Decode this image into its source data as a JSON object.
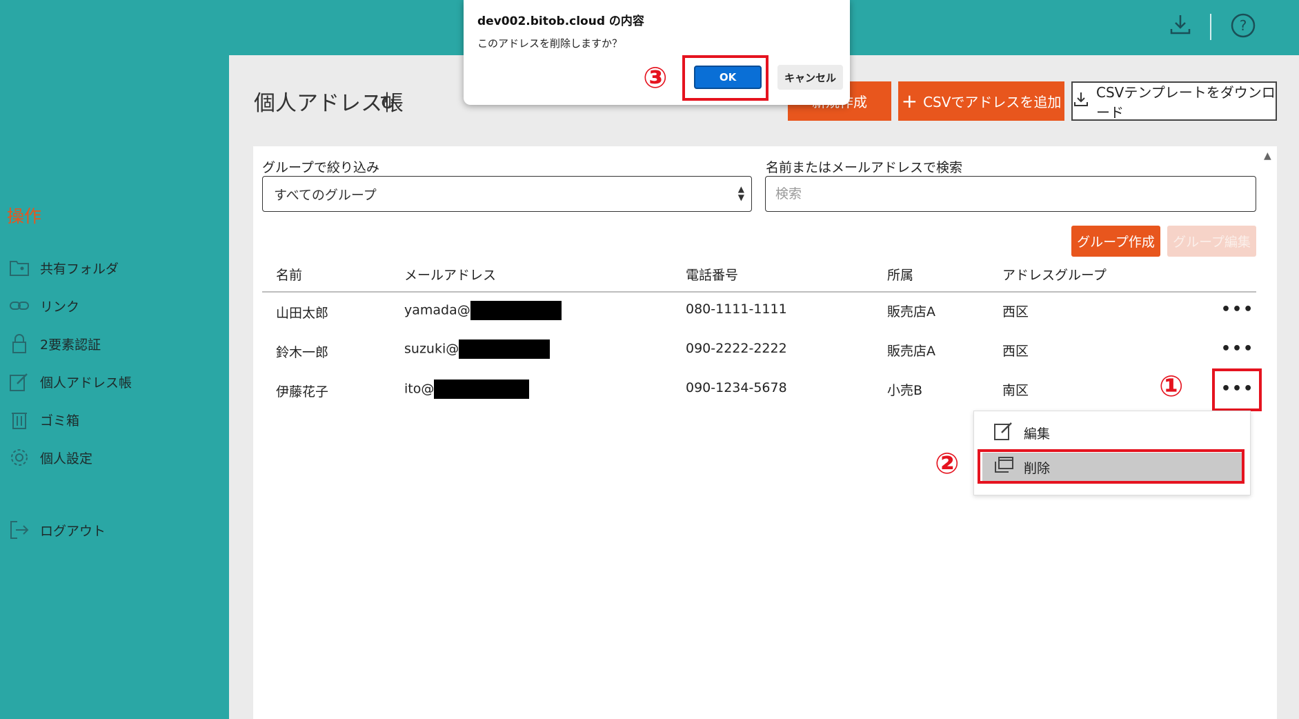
{
  "header": {
    "download_icon": "download-icon",
    "help_icon": "help-icon"
  },
  "sidebar": {
    "heading": "操作",
    "items": [
      {
        "label": "共有フォルダ",
        "icon": "shared-folder-icon"
      },
      {
        "label": "リンク",
        "icon": "link-icon"
      },
      {
        "label": "2要素認証",
        "icon": "lock-icon"
      },
      {
        "label": "個人アドレス帳",
        "icon": "edit-icon"
      },
      {
        "label": "ゴミ箱",
        "icon": "trash-icon"
      },
      {
        "label": "個人設定",
        "icon": "gear-icon"
      },
      {
        "label": "ログアウト",
        "icon": "logout-icon"
      }
    ]
  },
  "page": {
    "title": "個人アドレス帳",
    "new_button": "新規作成",
    "csv_add_button": "CSVでアドレスを追加",
    "csv_template_button": "CSVテンプレートをダウンロード"
  },
  "filters": {
    "group_label": "グループで絞り込み",
    "group_value": "すべてのグループ",
    "search_label": "名前またはメールアドレスで検索",
    "search_placeholder": "検索"
  },
  "group_buttons": {
    "create": "グループ作成",
    "edit": "グループ編集"
  },
  "table": {
    "columns": [
      "名前",
      "メールアドレス",
      "電話番号",
      "所属",
      "アドレスグループ"
    ],
    "rows": [
      {
        "name": "山田太郎",
        "email": "yamada@",
        "phone": "080-1111-1111",
        "affiliation": "販売店A",
        "group": "西区"
      },
      {
        "name": "鈴木一郎",
        "email": "suzuki@",
        "phone": "090-2222-2222",
        "affiliation": "販売店A",
        "group": "西区"
      },
      {
        "name": "伊藤花子",
        "email": "ito@",
        "phone": "090-1234-5678",
        "affiliation": "小売B",
        "group": "南区"
      }
    ],
    "more_label": "•••"
  },
  "context_menu": {
    "items": [
      "編集",
      "削除"
    ]
  },
  "annotations": {
    "step1": "①",
    "step2": "②",
    "step3": "③"
  },
  "dialog": {
    "title": "dev002.bitob.cloud の内容",
    "message": "このアドレスを削除しますか？",
    "ok": "OK",
    "cancel": "キャンセル"
  },
  "colors": {
    "teal": "#2aa7a5",
    "orange": "#e8561d",
    "highlight_red": "#e5131f",
    "ok_blue": "#0a6fd6"
  }
}
